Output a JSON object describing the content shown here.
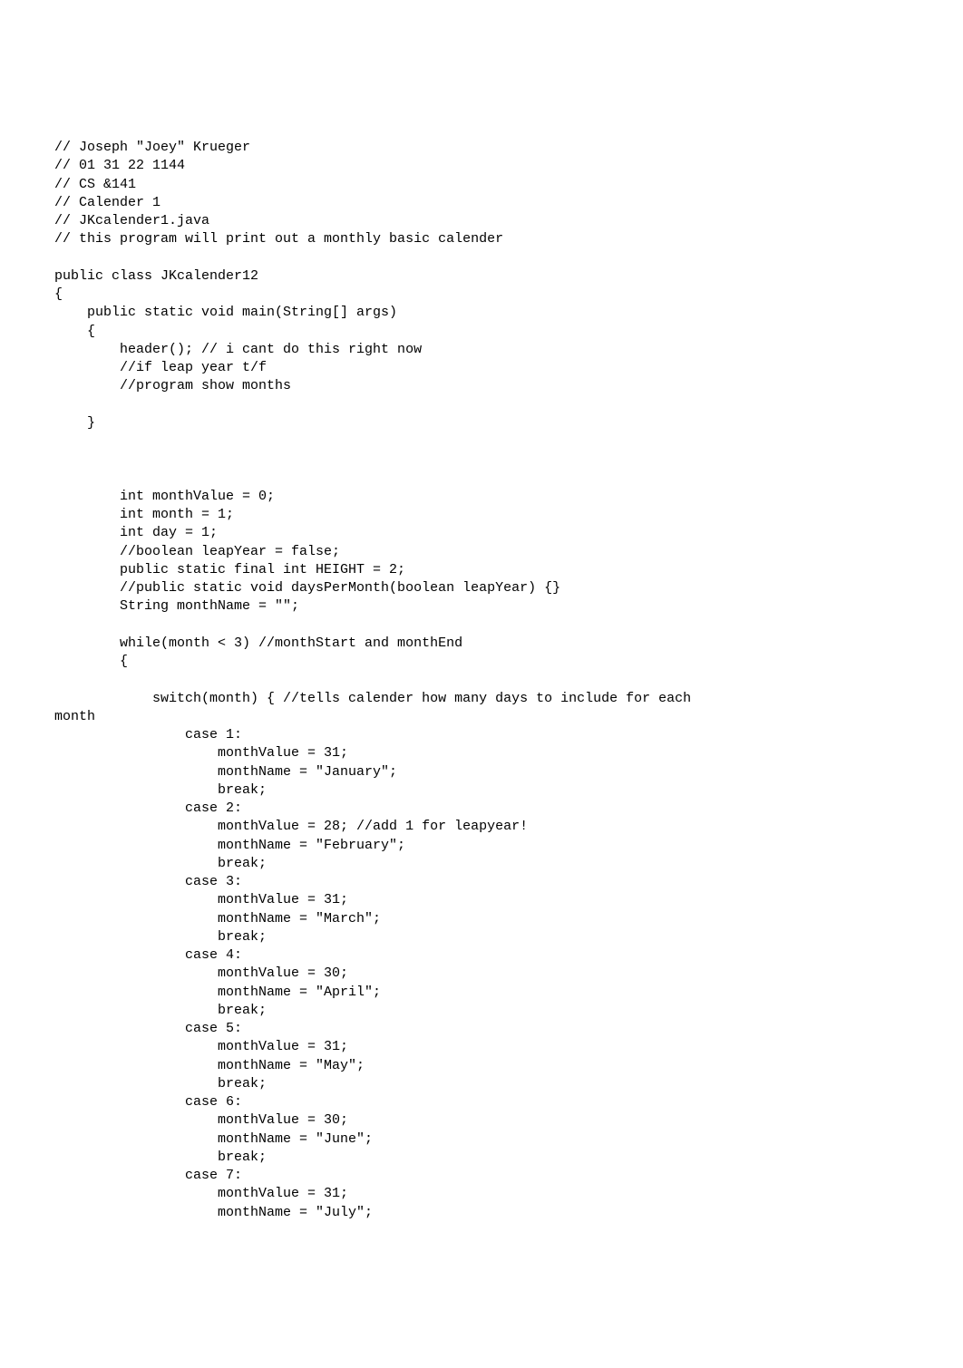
{
  "code": {
    "lines": [
      "// Joseph \"Joey\" Krueger",
      "// 01 31 22 1144",
      "// CS &141",
      "// Calender 1",
      "// JKcalender1.java",
      "// this program will print out a monthly basic calender",
      "",
      "public class JKcalender12",
      "{",
      "    public static void main(String[] args)",
      "    {",
      "        header(); // i cant do this right now",
      "        //if leap year t/f",
      "        //program show months",
      "",
      "    }",
      "",
      "",
      "",
      "        int monthValue = 0;",
      "        int month = 1;",
      "        int day = 1;",
      "        //boolean leapYear = false;",
      "        public static final int HEIGHT = 2;",
      "        //public static void daysPerMonth(boolean leapYear) {}",
      "        String monthName = \"\";",
      "",
      "        while(month < 3) //monthStart and monthEnd",
      "        {",
      "",
      "            switch(month) { //tells calender how many days to include for each",
      "month",
      "                case 1:",
      "                    monthValue = 31;",
      "                    monthName = \"January\";",
      "                    break;",
      "                case 2:",
      "                    monthValue = 28; //add 1 for leapyear!",
      "                    monthName = \"February\";",
      "                    break;",
      "                case 3:",
      "                    monthValue = 31;",
      "                    monthName = \"March\";",
      "                    break;",
      "                case 4:",
      "                    monthValue = 30;",
      "                    monthName = \"April\";",
      "                    break;",
      "                case 5:",
      "                    monthValue = 31;",
      "                    monthName = \"May\";",
      "                    break;",
      "                case 6:",
      "                    monthValue = 30;",
      "                    monthName = \"June\";",
      "                    break;",
      "                case 7:",
      "                    monthValue = 31;",
      "                    monthName = \"July\";"
    ]
  }
}
